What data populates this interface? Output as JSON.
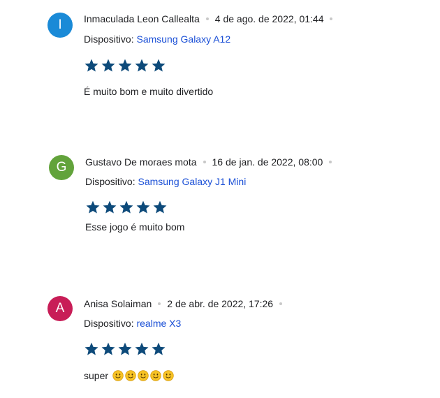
{
  "colors": {
    "star": "#0d4a7a",
    "link": "#1a4fd6",
    "dot": "#c8c8c8"
  },
  "reviews": [
    {
      "avatar_letter": "I",
      "avatar_color": "#1a8ad7",
      "author": "Inmaculada Leon Callealta",
      "date": "4 de ago. de 2022, 01:44",
      "device_label": "Dispositivo:",
      "device_name": "Samsung Galaxy A12",
      "rating": 5,
      "text": "É muito bom e muito divertido"
    },
    {
      "avatar_letter": "G",
      "avatar_color": "#62a33b",
      "author": "Gustavo De moraes mota",
      "date": "16 de jan. de 2022, 08:00",
      "device_label": "Dispositivo:",
      "device_name": "Samsung Galaxy J1 Mini",
      "rating": 5,
      "text": "Esse jogo é muito bom"
    },
    {
      "avatar_letter": "A",
      "avatar_color": "#c81d57",
      "author": "Anisa Solaiman",
      "date": "2 de abr. de 2022, 17:26",
      "device_label": "Dispositivo:",
      "device_name": "realme X3",
      "rating": 5,
      "text": "super",
      "emoji_icons": [
        "slightly-smiling-face-icon",
        "slightly-smiling-face-icon",
        "slightly-smiling-face-icon",
        "slightly-smiling-face-icon",
        "slightly-smiling-face-icon"
      ]
    }
  ]
}
